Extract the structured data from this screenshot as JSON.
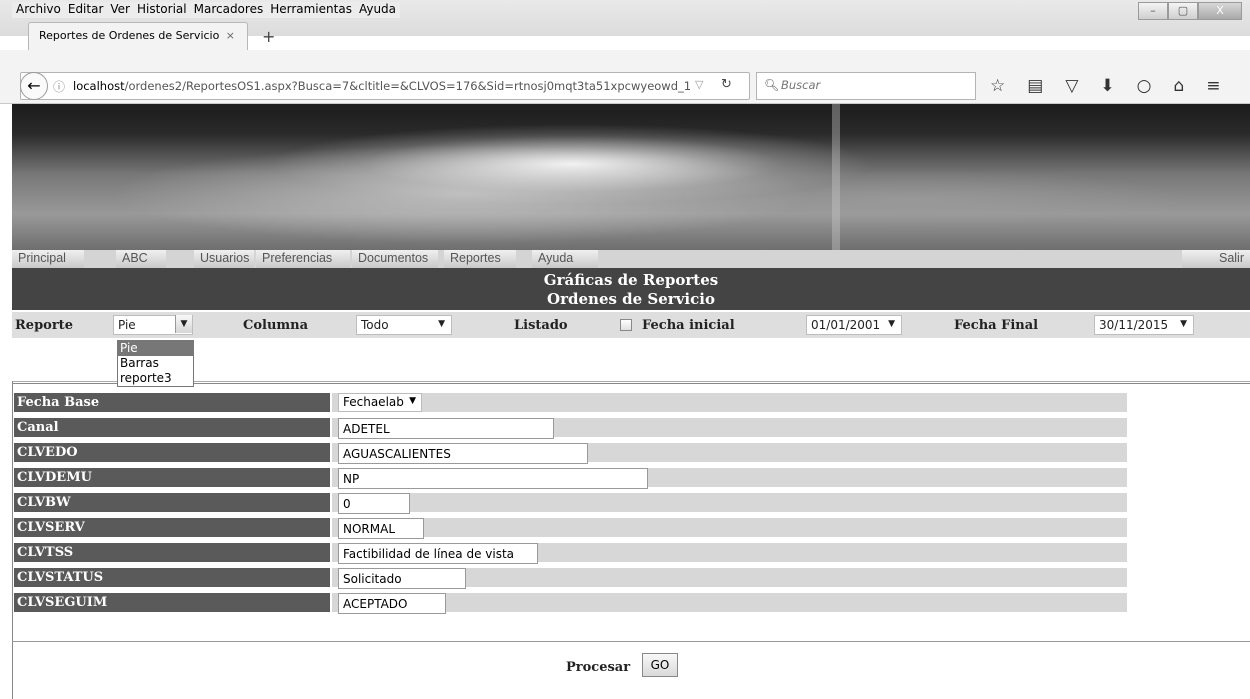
{
  "browser": {
    "menu": [
      "Archivo",
      "Editar",
      "Ver",
      "Historial",
      "Marcadores",
      "Herramientas",
      "Ayuda"
    ],
    "tab_title": "Reportes de Ordenes de Servicio",
    "tab_close": "×",
    "new_tab": "+",
    "url_host": "localhost",
    "url_path": "/ordenes2/ReportesOS1.aspx?Busca=7&cltitle=&CLVOS=176&Sid=rtnosj0mqt3ta51xpcwyeowd_1",
    "search_placeholder": "Buscar",
    "window_buttons": [
      "–",
      "▢",
      "X"
    ]
  },
  "site_nav": {
    "items": [
      "Principal",
      "ABC",
      "Usuarios",
      "Preferencias",
      "Documentos",
      "Reportes",
      "Ayuda"
    ],
    "logout": "Salir"
  },
  "header": {
    "title": "Gráficas de Reportes",
    "subtitle": "Ordenes de Servicio"
  },
  "filters": {
    "reporte_label": "Reporte",
    "reporte_value": "Pie",
    "reporte_options": [
      "Pie",
      "Barras",
      "reporte3"
    ],
    "columna_label": "Columna",
    "columna_value": "Todo",
    "listado_label": "Listado",
    "fecha_inicial_label": "Fecha inicial",
    "fecha_inicial_value": "01/01/2001",
    "fecha_final_label": "Fecha Final",
    "fecha_final_value": "30/11/2015"
  },
  "form": {
    "rows": [
      {
        "label": "Fecha Base",
        "value": "Fechaelab"
      },
      {
        "label": "Canal",
        "value": "ADETEL"
      },
      {
        "label": "CLVEDO",
        "value": "AGUASCALIENTES"
      },
      {
        "label": "CLVDEMU",
        "value": "NP"
      },
      {
        "label": "CLVBW",
        "value": "0"
      },
      {
        "label": "CLVSERV",
        "value": "NORMAL"
      },
      {
        "label": "CLVTSS",
        "value": "Factibilidad de línea de vista"
      },
      {
        "label": "CLVSTATUS",
        "value": "Solicitado"
      },
      {
        "label": "CLVSEGUIM",
        "value": "ACEPTADO"
      }
    ]
  },
  "actions": {
    "procesar_label": "Procesar",
    "go_label": "GO"
  }
}
